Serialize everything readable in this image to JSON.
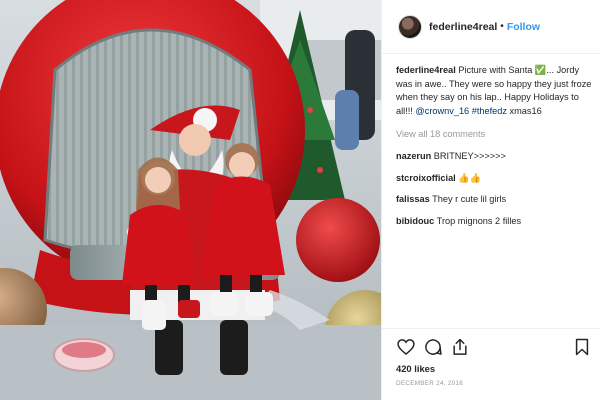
{
  "post": {
    "username": "federline4real",
    "separator": "•",
    "follow_label": "Follow"
  },
  "caption": {
    "username": "federline4real",
    "text": "Picture with Santa ✅... Jordy was in awe.. They were so happy they just froze when they say on his lap.. Happy Holidays to all!!! ",
    "mention": "@crownv_16",
    "hashtag": "#thefedz",
    "tail": "xmas16"
  },
  "view_all_label": "View all 18 comments",
  "comments": [
    {
      "username": "nazerun",
      "text": "BRITNEY>>>>>>"
    },
    {
      "username": "stcroixofficial",
      "text": "👍👍"
    },
    {
      "username": "falissas",
      "text": "They r cute lil girls"
    },
    {
      "username": "bibidouc",
      "text": "Trop mignons 2 filles"
    }
  ],
  "actions": {
    "icons": [
      "heart-icon",
      "comment-icon",
      "share-icon",
      "bookmark-icon"
    ],
    "likes": "420 likes",
    "date": "DECEMBER 24, 2016"
  },
  "colors": {
    "link": "#3897f0",
    "muted": "#999999",
    "text": "#262626",
    "ornament_red": "#d61f24"
  }
}
